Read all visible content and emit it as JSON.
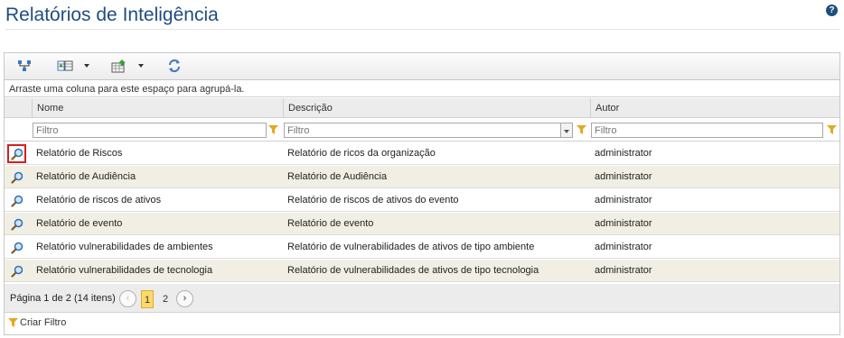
{
  "page": {
    "title": "Relatórios de Inteligência",
    "help_icon": "question-icon",
    "help_glyph": "?"
  },
  "toolbar": {
    "buttons": [
      {
        "icon": "column-hierarchy-icon"
      },
      {
        "icon": "columns-chooser-icon"
      },
      {
        "icon": "export-icon"
      },
      {
        "icon": "refresh-icon"
      }
    ]
  },
  "grid": {
    "group_hint": "Arraste uma coluna para este espaço para agrupá-la.",
    "columns": [
      "Nome",
      "Descrição",
      "Autor"
    ],
    "filter_placeholder": "Filtro",
    "rows": [
      {
        "nome": "Relatório de Riscos",
        "descricao": "Relatório de ricos da organização",
        "autor": "administrator"
      },
      {
        "nome": "Relatório de Audiência",
        "descricao": "Relatório de Audiência",
        "autor": "administrator"
      },
      {
        "nome": "Relatório de riscos de ativos",
        "descricao": "Relatório de riscos de ativos do evento",
        "autor": "administrator"
      },
      {
        "nome": "Relatório de evento",
        "descricao": "Relatório de evento",
        "autor": "administrator"
      },
      {
        "nome": "Relatório vulnerabilidades de ambientes",
        "descricao": "Relatório de vulnerabilidades de ativos de tipo ambiente",
        "autor": "administrator"
      },
      {
        "nome": "Relatório vulnerabilidades de tecnologia",
        "descricao": "Relatório de vulnerabilidades de ativos de tipo tecnologia",
        "autor": "administrator"
      }
    ],
    "selected_row_index": 0,
    "row_icon": "magnifier-icon"
  },
  "pager": {
    "info": "Página 1 de 2 (14 itens)",
    "current_page": "1",
    "other_page": "2",
    "prev_glyph": "‹",
    "next_glyph": "›"
  },
  "footer": {
    "create_filter": "Criar Filtro"
  },
  "colors": {
    "title": "#1f4d7e",
    "alt_row": "#f1efe4",
    "selection_border": "#d41f1f",
    "current_page": "#fdd968"
  }
}
